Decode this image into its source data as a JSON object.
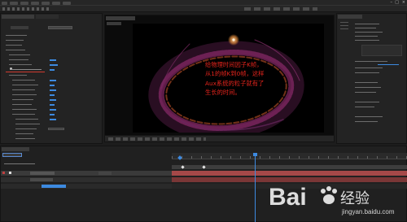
{
  "app": {
    "title": "",
    "window_controls": [
      "–",
      "□",
      "×"
    ]
  },
  "project": {
    "tab_title": "",
    "search_placeholder": ""
  },
  "effects": {
    "tab_title": "",
    "header": "",
    "button": ""
  },
  "viewer": {
    "tab_title": "",
    "comp_name": "",
    "zoom": "",
    "time": ""
  },
  "right": {
    "tab_title": "",
    "files": ""
  },
  "timeline": {
    "tab_title": "",
    "current_time": "",
    "layer_name": "",
    "marker": ""
  },
  "annotation": {
    "text": "给物理时间因子K帧，\n从1的帧K到0帧，这样\nAux系统的粒子就有了\n生长的时间。"
  },
  "watermark": {
    "brand": "Bai",
    "brand_suffix": "经验",
    "url": "jingyan.baidu.com"
  },
  "colors": {
    "annotation": "#e5241c",
    "particle_outer": "#9b2f76",
    "particle_inner": "#d05a2c",
    "accent_blue": "#3d8ae0",
    "timeline_layer": "#a54848"
  }
}
